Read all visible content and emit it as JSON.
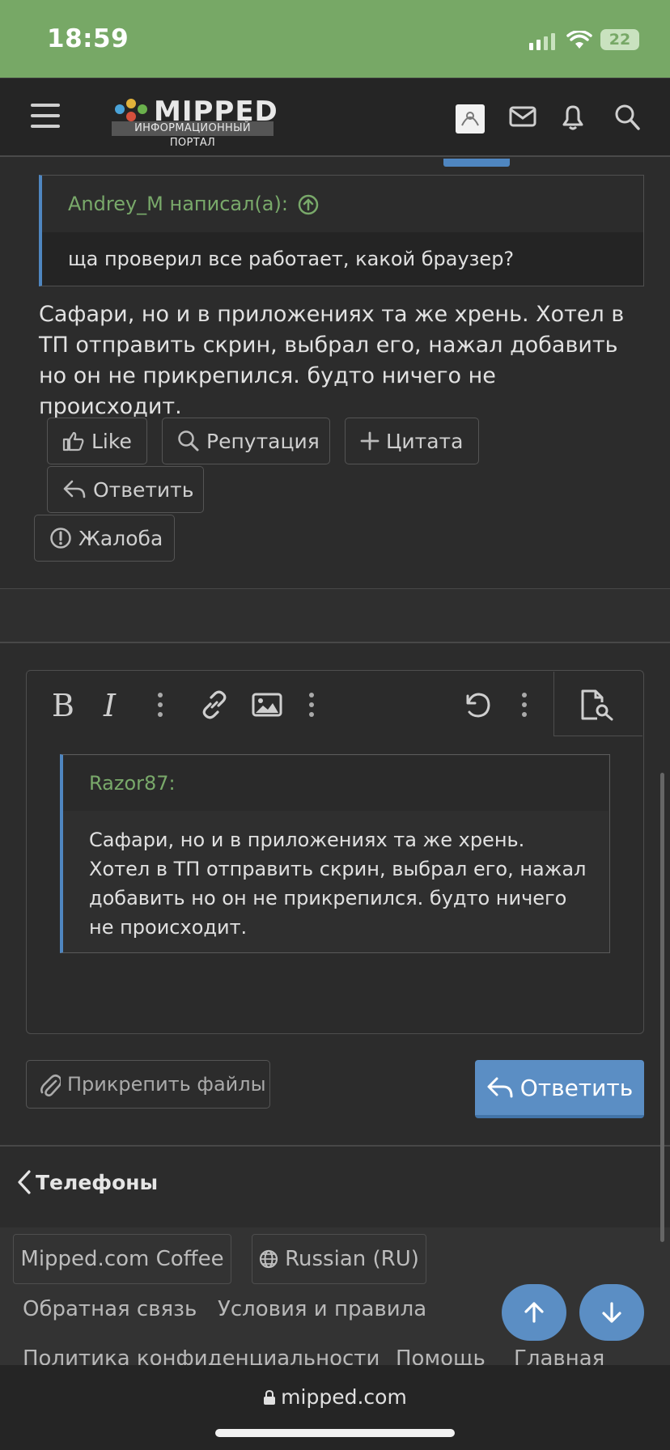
{
  "status": {
    "time": "18:59",
    "battery": "22"
  },
  "header": {
    "logo": "MIPPED",
    "logo_sub": "ИНФОРМАЦИОННЫЙ ПОРТАЛ"
  },
  "quote1": {
    "author": "Andrey_M написал(а):",
    "text": "ща проверил все работает, какой браузер?"
  },
  "post": {
    "text": "Сафари, но и в приложениях та же хрень. Хотел в ТП отправить скрин, выбрал его, нажал добавить но он не прикрепился. будто ничего не происходит."
  },
  "actions": {
    "like": "Like",
    "rep": "Репутация",
    "quote": "Цитата",
    "reply": "Ответить",
    "report": "Жалоба"
  },
  "editor": {
    "quote_author": "Razor87:",
    "quote_text": "Сафари, но и в приложениях та же хрень. Хотел в ТП отправить скрин, выбрал его, нажал добавить но он не прикрепился. будто ничего не происходит."
  },
  "form": {
    "attach": "Прикрепить файлы",
    "submit": "Ответить"
  },
  "breadcrumb": "Телефоны",
  "footer": {
    "style": "Mipped.com Coffee",
    "language": "Russian (RU)",
    "links": [
      "Обратная связь",
      "Условия и правила",
      "Политика конфиденциальности",
      "Помощь",
      "Главная"
    ]
  },
  "browser": {
    "url": "mipped.com"
  }
}
